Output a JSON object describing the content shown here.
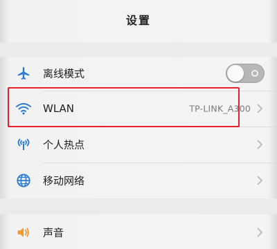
{
  "header": {
    "title": "设置"
  },
  "settings": {
    "airplane": {
      "label": "离线模式",
      "icon": "airplane-icon",
      "toggle_on": false
    },
    "wlan": {
      "label": "WLAN",
      "value": "TP-LINK_A300",
      "icon": "wifi-icon"
    },
    "hotspot": {
      "label": "个人热点",
      "icon": "hotspot-icon"
    },
    "mobile_network": {
      "label": "移动网络",
      "icon": "globe-icon"
    },
    "sound": {
      "label": "声音",
      "icon": "speaker-icon"
    }
  },
  "colors": {
    "accent_blue": "#2b7bd6",
    "highlight_red": "#e8202a",
    "sound_orange": "#f29a2e"
  }
}
